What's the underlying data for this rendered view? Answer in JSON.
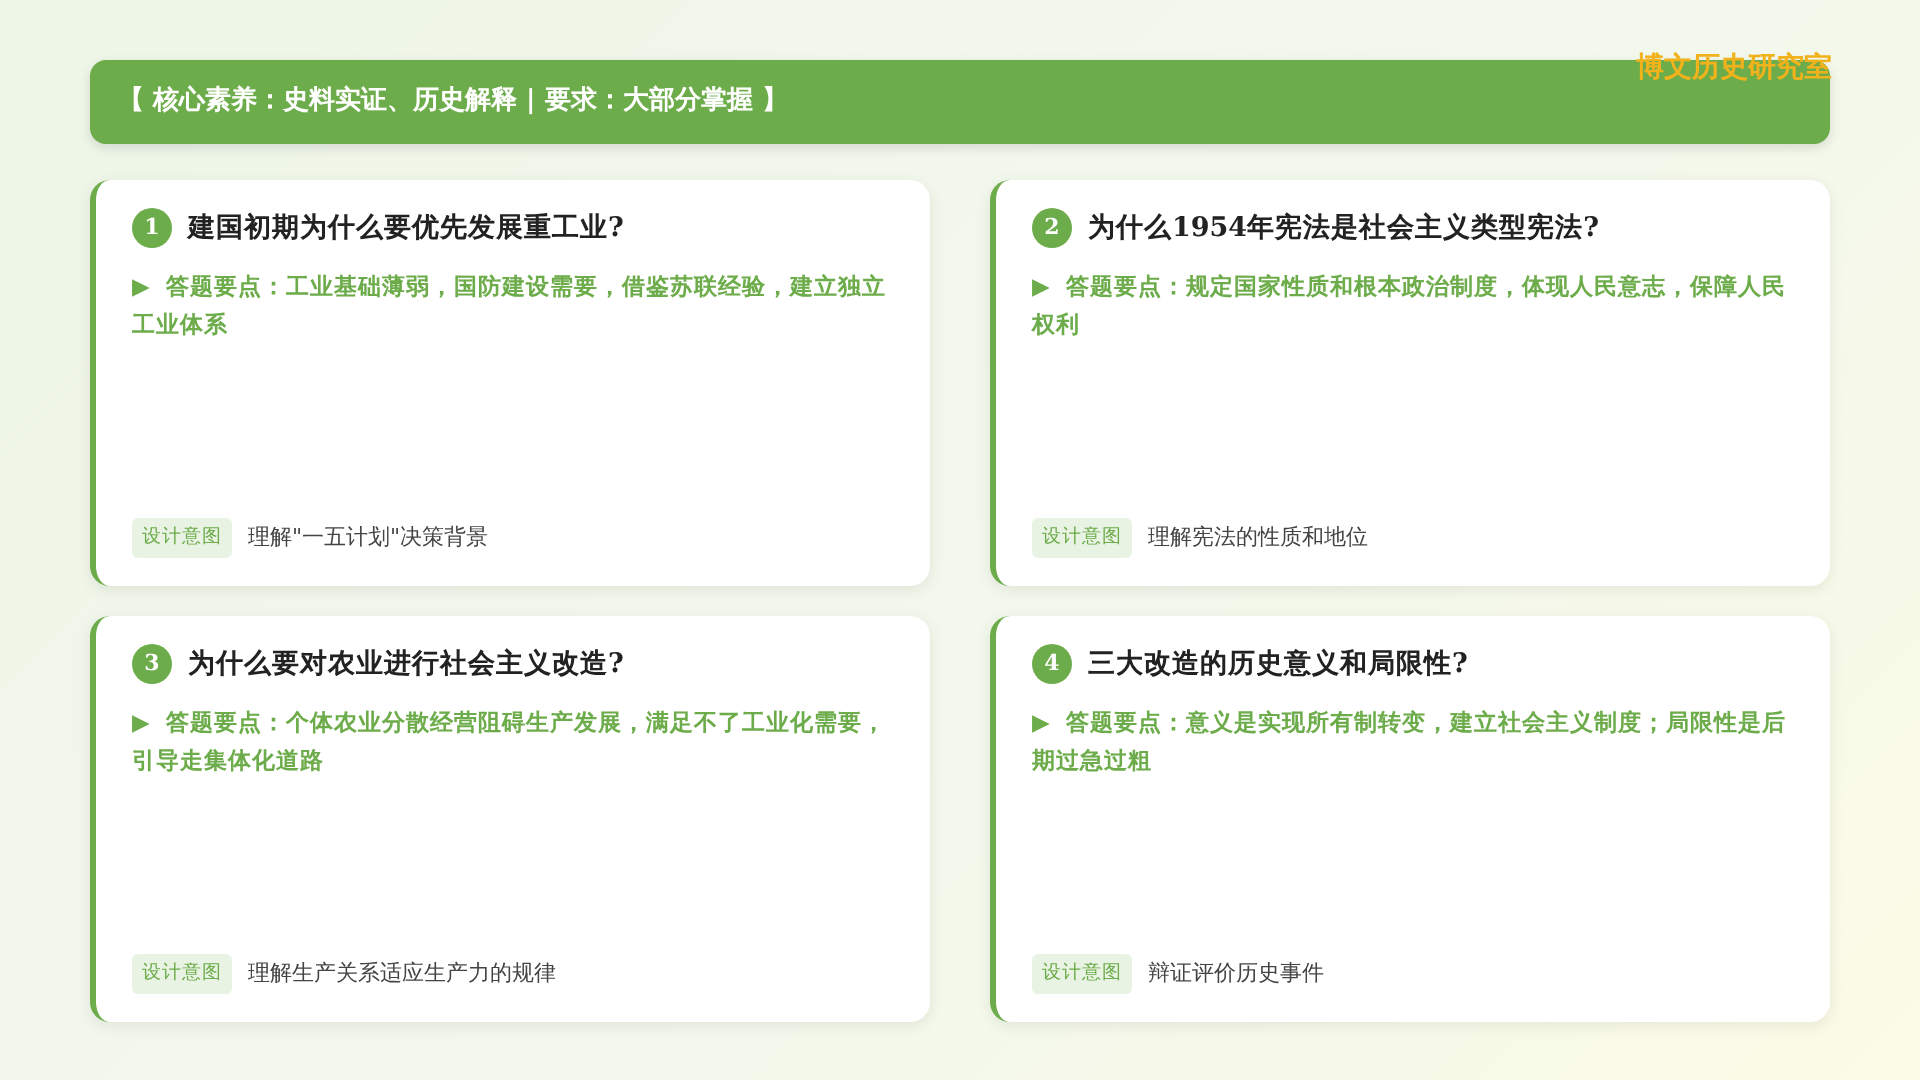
{
  "brand": "博文历史研究室",
  "header": "【 核心素养：史料实证、历史解释 | 要求：大部分掌握 】",
  "questions": [
    {
      "number": "1",
      "title": "建国初期为什么要优先发展重工业?",
      "answer": "▶  答题要点：工业基础薄弱，国防建设需要，借鉴苏联经验，建立独立工业体系",
      "tag": "设计意图",
      "intent": "理解\"一五计划\"决策背景"
    },
    {
      "number": "2",
      "title": "为什么1954年宪法是社会主义类型宪法?",
      "answer": "▶  答题要点：规定国家性质和根本政治制度，体现人民意志，保障人民权利",
      "tag": "设计意图",
      "intent": "理解宪法的性质和地位"
    },
    {
      "number": "3",
      "title": "为什么要对农业进行社会主义改造?",
      "answer": "▶  答题要点：个体农业分散经营阻碍生产发展，满足不了工业化需要，引导走集体化道路",
      "tag": "设计意图",
      "intent": "理解生产关系适应生产力的规律"
    },
    {
      "number": "4",
      "title": "三大改造的历史意义和局限性?",
      "answer": "▶  答题要点：意义是实现所有制转变，建立社会主义制度；局限性是后期过急过粗",
      "tag": "设计意图",
      "intent": "辩证评价历史事件"
    }
  ]
}
